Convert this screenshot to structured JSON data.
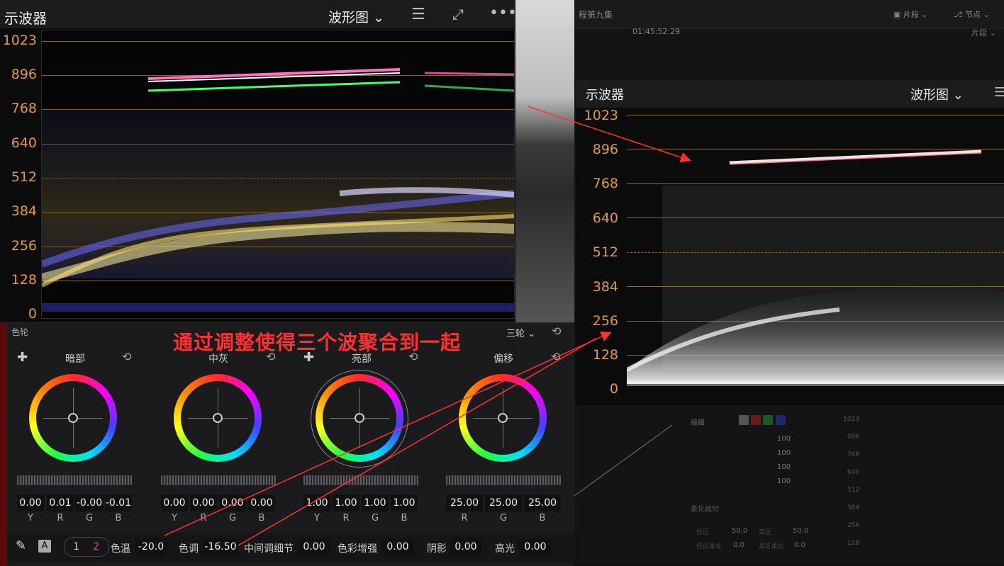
{
  "left_scope": {
    "title": "示波器",
    "mode": "波形图",
    "y_labels": [
      "1023",
      "896",
      "768",
      "640",
      "512",
      "384",
      "256",
      "128",
      "0"
    ]
  },
  "right_scope": {
    "title": "示波器",
    "mode": "波形图",
    "y_labels": [
      "1023",
      "896",
      "768",
      "640",
      "512",
      "384",
      "256",
      "128",
      "0"
    ]
  },
  "top_right_bar": {
    "project_title": "程第九集",
    "clip_label": "片段",
    "node_label": "节点",
    "timecode": "01:45:52:29",
    "clip_label2": "片段"
  },
  "color_wheels": {
    "panel_label": "色轮",
    "mode_label": "三轮",
    "wheels": [
      {
        "name": "暗部",
        "values": [
          "0.00",
          "0.01",
          "-0.00",
          "-0.01"
        ],
        "channels": [
          "Y",
          "R",
          "G",
          "B"
        ]
      },
      {
        "name": "中灰",
        "values": [
          "0.00",
          "0.00",
          "0.00",
          "0.00"
        ],
        "channels": [
          "Y",
          "R",
          "G",
          "B"
        ]
      },
      {
        "name": "亮部",
        "values": [
          "1.00",
          "1.00",
          "1.00",
          "1.00"
        ],
        "channels": [
          "Y",
          "R",
          "G",
          "B"
        ]
      },
      {
        "name": "偏移",
        "values": [
          "25.00",
          "25.00",
          "25.00"
        ],
        "channels": [
          "R",
          "G",
          "B"
        ]
      }
    ]
  },
  "bottom_bar": {
    "page1": "1",
    "page2": "2",
    "a_label": "A",
    "temp_label": "色温",
    "temp_value": "-20.0",
    "tint_label": "色调",
    "tint_value": "-16.50",
    "midtone_label": "中间调细节",
    "midtone_value": "0.00",
    "color_boost_label": "色彩增强",
    "color_boost_value": "0.00",
    "shadow_label": "阴影",
    "shadow_value": "0.00",
    "highlight_label": "高光",
    "highlight_value": "0.00"
  },
  "right_lower": {
    "edit_label": "编辑",
    "channel_values": [
      "100",
      "100",
      "100",
      "100"
    ],
    "soft_clip_label": "柔化裁切",
    "low_label": "低区",
    "high_label": "高区",
    "low_value": "50.0",
    "high_value": "50.0",
    "low_soft_label": "低区柔化",
    "high_soft_label": "高区柔化",
    "low_soft_value": "0.0",
    "high_soft_value": "0.0",
    "mini_scale": [
      "1023",
      "896",
      "768",
      "640",
      "512",
      "384",
      "256",
      "128",
      "0"
    ]
  },
  "caption": "通过调整使得三个波聚合到一起",
  "colors": {
    "axis_label": "#e09a3a",
    "grid": "#b08a2a",
    "annotation": "#ff3030"
  }
}
